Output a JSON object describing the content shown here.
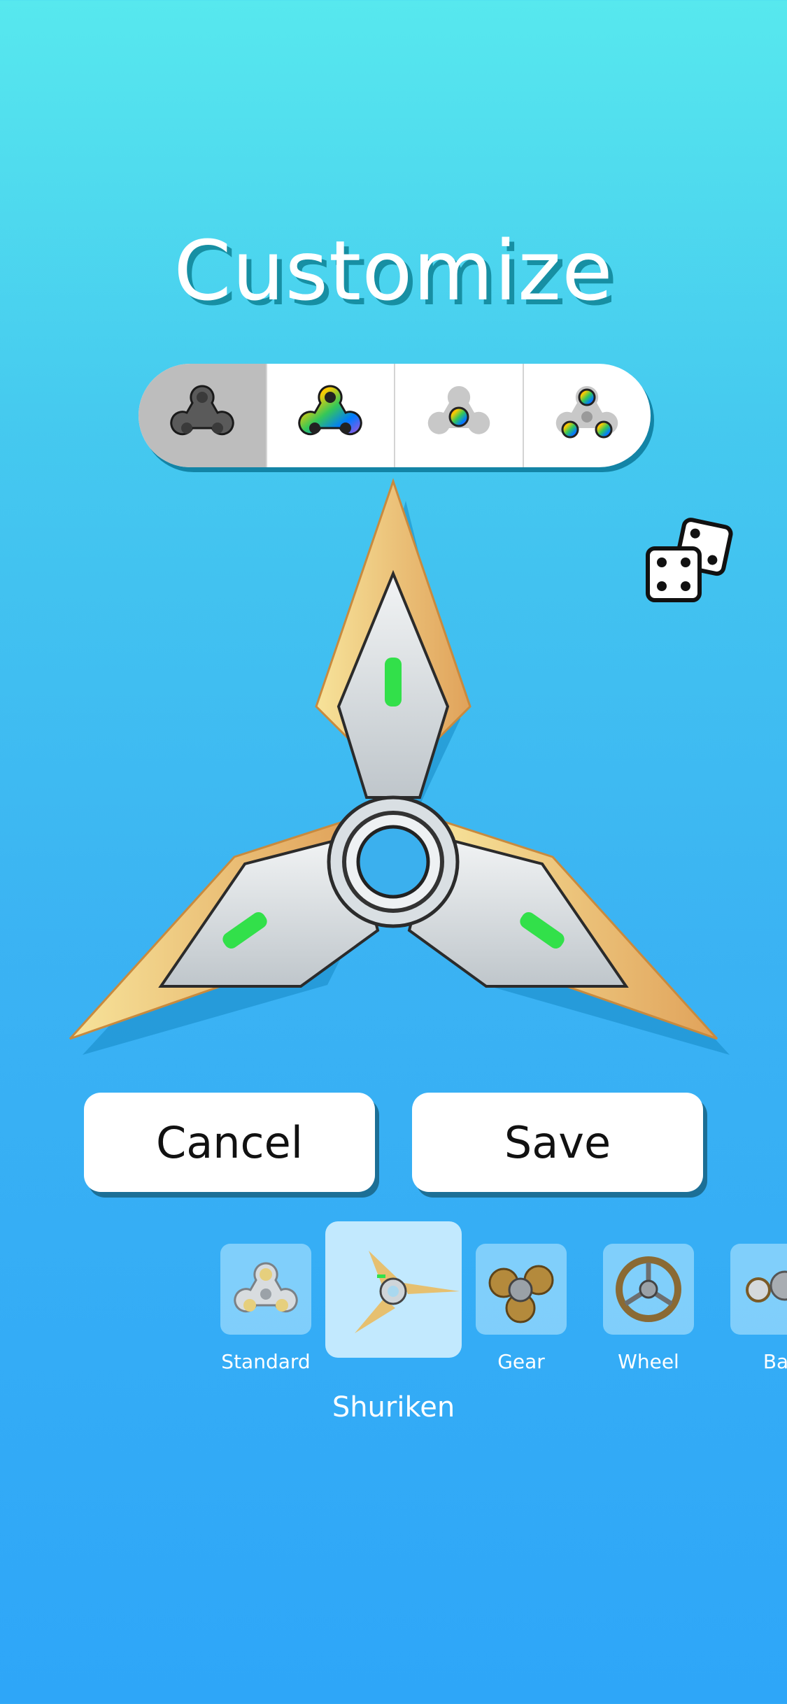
{
  "screen": {
    "title": "Customize"
  },
  "style_tabs": [
    {
      "icon": "plain-spinner-icon",
      "active": true
    },
    {
      "icon": "rainbow-spinner-icon",
      "active": false
    },
    {
      "icon": "rainbow-center-icon",
      "active": false
    },
    {
      "icon": "rainbow-bearings-icon",
      "active": false
    }
  ],
  "randomize": {
    "icon": "dice-icon"
  },
  "preview": {
    "icon": "shuriken-spinner-preview"
  },
  "buttons": {
    "cancel_label": "Cancel",
    "save_label": "Save"
  },
  "spinners": [
    {
      "label": "Standard",
      "icon": "standard-spinner-icon",
      "selected": false
    },
    {
      "label": "Shuriken",
      "icon": "shuriken-spinner-icon",
      "selected": true
    },
    {
      "label": "Gear",
      "icon": "gear-spinner-icon",
      "selected": false
    },
    {
      "label": "Wheel",
      "icon": "wheel-spinner-icon",
      "selected": false
    },
    {
      "label": "Ba",
      "icon": "partial-spinner-icon",
      "selected": false
    }
  ],
  "colors": {
    "accent_green": "#32e04a",
    "blade_gold": "#e9b25c",
    "title_shadow": "#178fa3"
  }
}
